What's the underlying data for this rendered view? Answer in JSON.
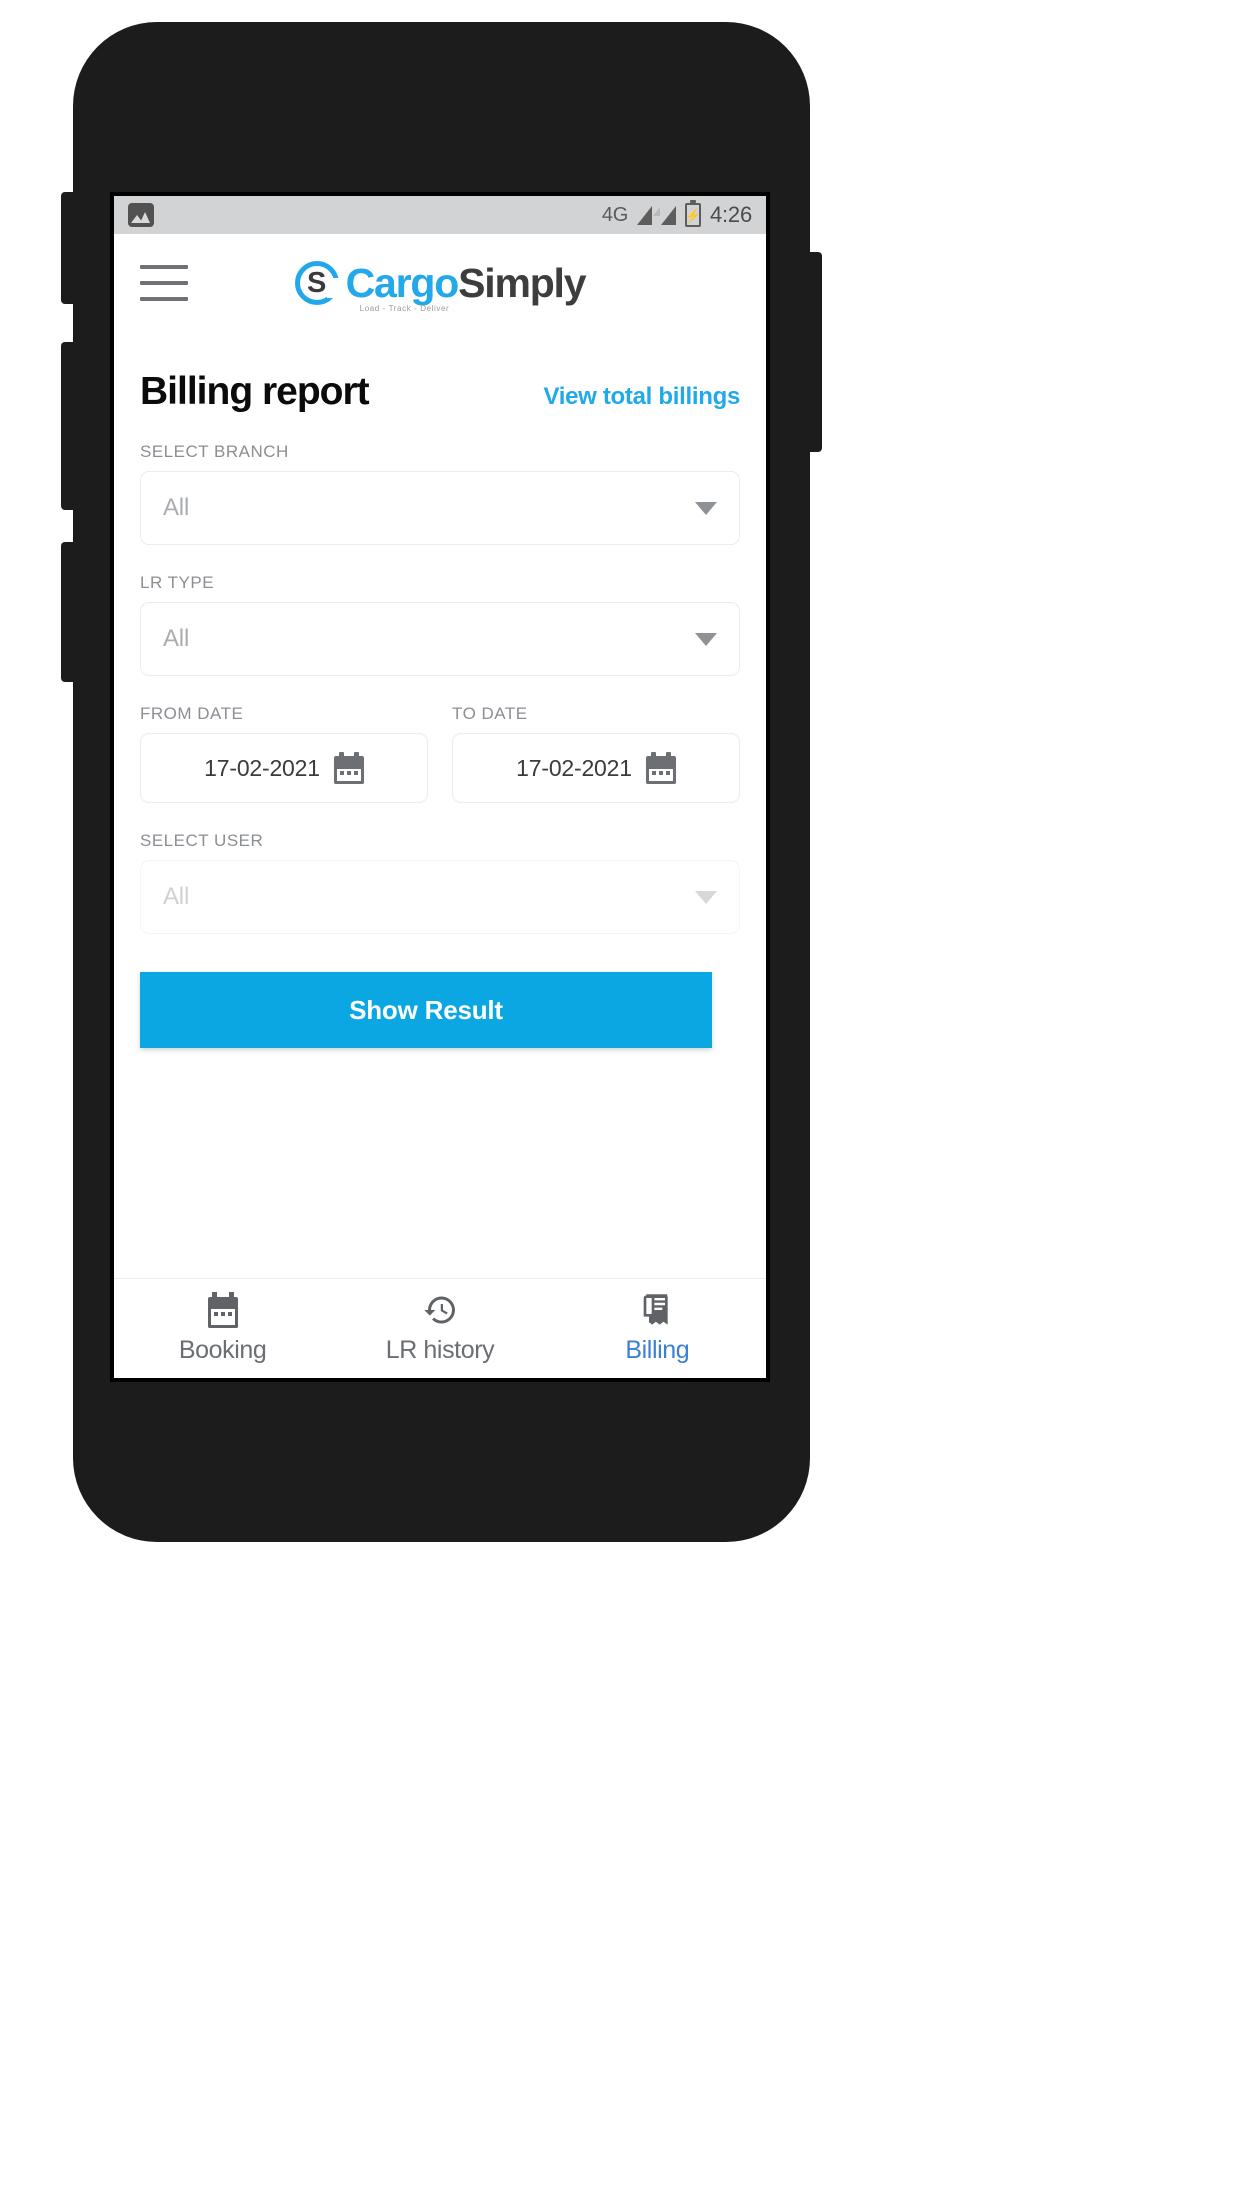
{
  "status_bar": {
    "gallery_icon": "image-icon",
    "network_type": "4G",
    "signal_icons": [
      "signal-bars-partial-icon",
      "signal-bars-full-icon"
    ],
    "battery_icon": "battery-charging-icon",
    "clock": "4:26"
  },
  "header": {
    "menu_icon": "hamburger-menu-icon",
    "logo": {
      "mark_letter": "S",
      "word_primary": "Cargo",
      "word_secondary": "Simply",
      "tagline": "Load - Track - Deliver"
    }
  },
  "main": {
    "page_title": "Billing report",
    "view_total_link": "View total billings",
    "fields": {
      "branch": {
        "label": "SELECT BRANCH",
        "value": "All",
        "caret_icon": "chevron-down-icon"
      },
      "lr_type": {
        "label": "LR TYPE",
        "value": "All",
        "caret_icon": "chevron-down-icon"
      },
      "from_date": {
        "label": "FROM DATE",
        "value": "17-02-2021",
        "icon": "calendar-icon"
      },
      "to_date": {
        "label": "TO DATE",
        "value": "17-02-2021",
        "icon": "calendar-icon"
      },
      "user": {
        "label": "SELECT USER",
        "value": "All",
        "caret_icon": "chevron-down-icon"
      }
    },
    "submit_button": "Show Result"
  },
  "bottom_nav": {
    "items": [
      {
        "label": "Booking",
        "icon": "calendar-icon",
        "active": false
      },
      {
        "label": "LR history",
        "icon": "history-icon",
        "active": false
      },
      {
        "label": "Billing",
        "icon": "receipt-icon",
        "active": true
      }
    ]
  },
  "colors": {
    "brand_blue": "#21a9e9",
    "button_blue": "#0aa7e3",
    "active_nav_blue": "#3c7fd6",
    "label_gray": "#8b8e93",
    "status_bar_gray": "#d2d3d5"
  }
}
